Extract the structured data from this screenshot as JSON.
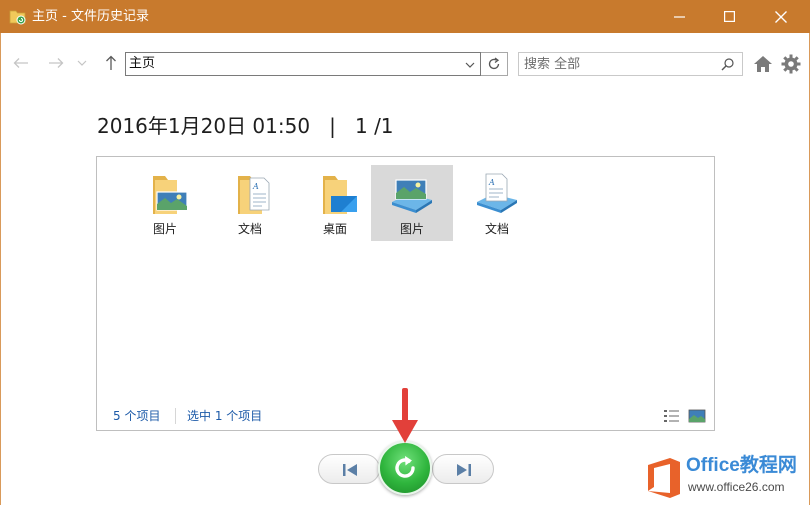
{
  "window": {
    "title": "主页 - 文件历史记录",
    "accent": "#c87a2d"
  },
  "toolbar": {
    "address": "主页",
    "search_placeholder": "搜索 全部"
  },
  "heading": {
    "date": "2016年1月20日 01:50",
    "separator": "|",
    "page": "1 /1"
  },
  "items": [
    {
      "label": "图片",
      "icon": "pictures-folder-icon",
      "selected": false
    },
    {
      "label": "文档",
      "icon": "documents-folder-icon",
      "selected": false
    },
    {
      "label": "桌面",
      "icon": "desktop-folder-icon",
      "selected": false
    },
    {
      "label": "图片",
      "icon": "pictures-library-icon",
      "selected": true
    },
    {
      "label": "文档",
      "icon": "documents-library-icon",
      "selected": false
    }
  ],
  "status": {
    "count": "5 个项目",
    "selected": "选中 1 个项目"
  },
  "watermark": {
    "brand": "Office教程网",
    "url": "www.office26.com",
    "color": "#3a8ad6"
  }
}
